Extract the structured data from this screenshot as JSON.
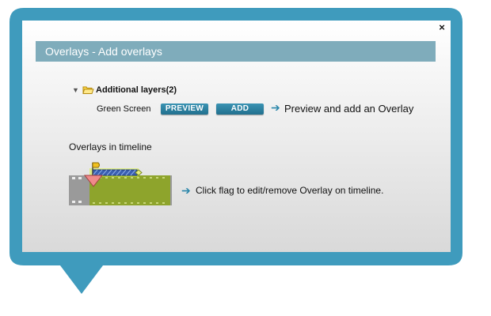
{
  "dialog": {
    "title": "Overlays - Add overlays",
    "close_label": "×"
  },
  "layers": {
    "group_label": "Additional layers(2)",
    "item_label": "Green Screen",
    "preview_button": "PREVIEW",
    "add_button": "ADD",
    "hint_arrow": "➔",
    "hint": "Preview and add an Overlay"
  },
  "timeline_section": {
    "title": "Overlays in timeline",
    "hint_arrow": "➔",
    "hint": "Click flag to edit/remove Overlay on timeline."
  },
  "colors": {
    "bubble_border": "#3f9bbd",
    "header_bg": "#7facbb",
    "button_bg": "#2b82a3",
    "film_green": "#8ea42c",
    "marker_pink": "#f08a8a"
  }
}
